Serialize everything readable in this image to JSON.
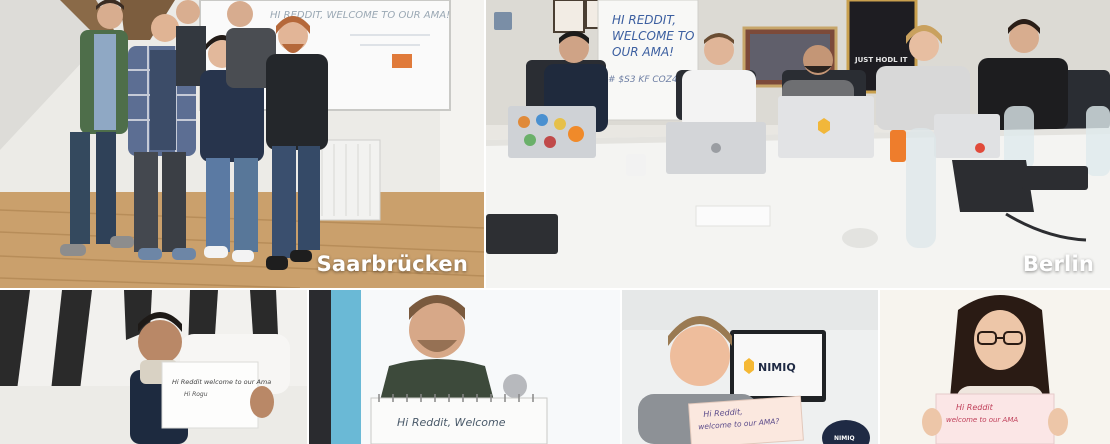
{
  "labels": {
    "saarbruecken": "Saarbrücken",
    "berlin": "Berlin"
  },
  "signs": {
    "whiteboard": "HI REDDIT, WELCOME TO OUR AMA!",
    "berlin_board_line1": "HI REDDIT,",
    "berlin_board_line2": "WELCOME TO",
    "berlin_board_line3": "OUR AMA!",
    "berlin_board_hashtag": "# $S3 KF COZ4S",
    "poster": "JUST HODL IT",
    "paper1_line1": "Hi Reddit welcome to our Ama",
    "paper1_line2": "Hi Rogu",
    "notebook": "Hi Reddit, Welcome",
    "paper3_line1": "Hi Reddit,",
    "paper3_line2": "welcome to our AMA?",
    "paper4_line1": "Hi Reddit",
    "paper4_line2": "welcome to our AMA"
  },
  "logos": {
    "monitor": "NIMIQ",
    "cap": "NIMIQ"
  }
}
